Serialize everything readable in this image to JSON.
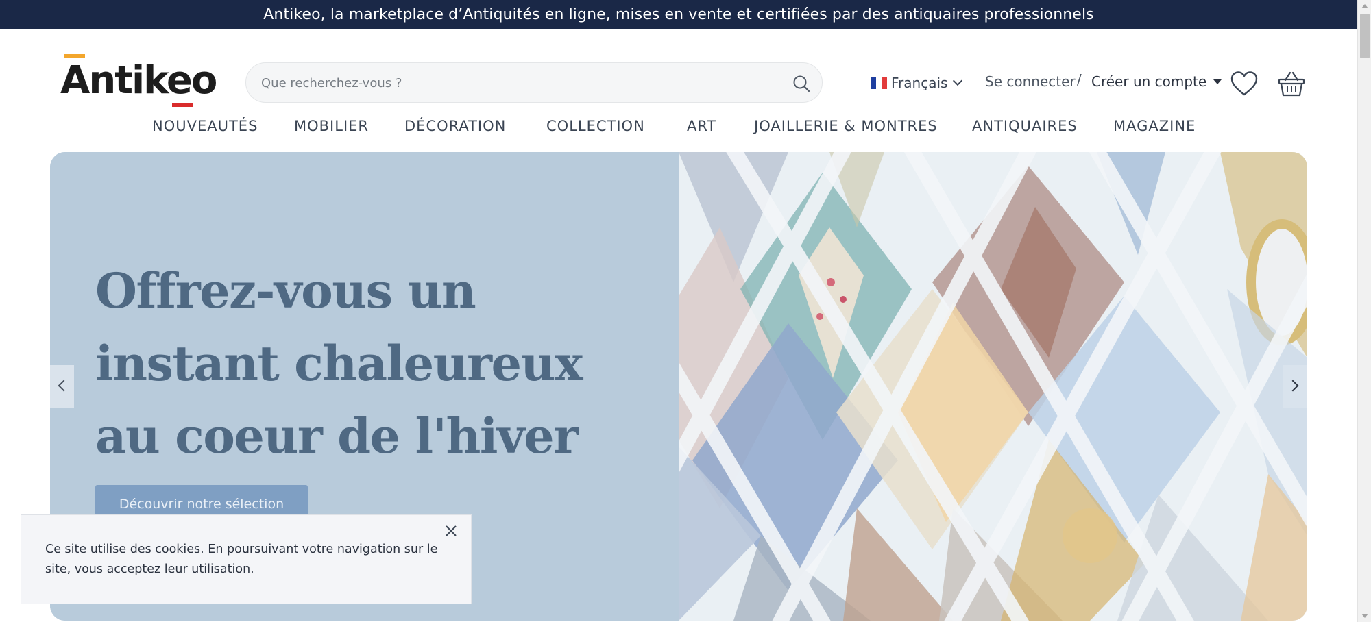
{
  "announcement": "Antikeo, la marketplace d’Antiquités en ligne, mises en vente et certifiées par des antiquaires professionnels",
  "logo": {
    "text": "Antikeo",
    "colors": {
      "top_bar": "#f3a62c",
      "bottom_bar": "#d92b2b"
    }
  },
  "search": {
    "placeholder": "Que recherchez-vous ?",
    "value": ""
  },
  "language": {
    "label": "Français",
    "flag": "fr-flag-icon"
  },
  "account": {
    "login": "Se connecter",
    "separator": "/",
    "register": "Créer un compte"
  },
  "icons": {
    "wishlist": "heart-icon",
    "cart": "basket-icon",
    "search": "search-icon"
  },
  "nav": {
    "items": [
      {
        "label": "NOUVEAUTÉS"
      },
      {
        "label": "MOBILIER"
      },
      {
        "label": "DÉCORATION"
      },
      {
        "label": "COLLECTION"
      },
      {
        "label": "ART"
      },
      {
        "label": "JOAILLERIE & MONTRES"
      },
      {
        "label": "ANTIQUAIRES"
      },
      {
        "label": "MAGAZINE"
      }
    ]
  },
  "hero": {
    "title": "Offrez-vous un instant chaleureux au coeur de l'hiver",
    "cta": "Découvrir notre sélection"
  },
  "cookie": {
    "text": "Ce site utilise des cookies. En poursuivant votre navigation sur le site, vous acceptez leur utilisation."
  },
  "colors": {
    "announcement_bg": "#1a2847",
    "hero_bg": "#b8cbdb",
    "hero_title": "#4f6983",
    "cta_bg": "#7f9fc3"
  }
}
